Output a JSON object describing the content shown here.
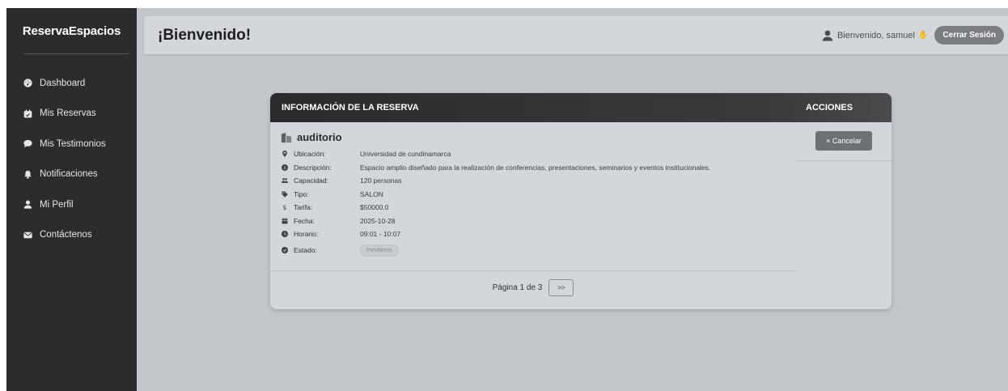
{
  "sidebar": {
    "brand": "ReservaEspacios",
    "items": [
      {
        "label": "Dashboard",
        "icon": "dashboard-icon"
      },
      {
        "label": "Mis Reservas",
        "icon": "calendar-icon"
      },
      {
        "label": "Mis Testimonios",
        "icon": "comment-icon"
      },
      {
        "label": "Notificaciones",
        "icon": "bell-icon"
      },
      {
        "label": "Mi Perfil",
        "icon": "user-icon"
      },
      {
        "label": "Contáctenos",
        "icon": "envelope-icon"
      }
    ]
  },
  "header": {
    "title": "¡Bienvenido!",
    "welcome": "Bienvenido, samuel",
    "logout_label": "Cerrar Sesión"
  },
  "card": {
    "info_header": "INFORMACIÓN DE LA RESERVA",
    "actions_header": "ACCIONES",
    "cancel_label": "× Cancelar",
    "space_name": "auditorio",
    "fields": {
      "ubicacion": {
        "label": "Ubicación:",
        "value": "Universidad de cundinamarca"
      },
      "descripcion": {
        "label": "Descripción:",
        "value": "Espacio amplio diseñado para la realización de conferencias, presentaciones, seminarios y eventos institucionales."
      },
      "capacidad": {
        "label": "Capacidad:",
        "value": "120 personas"
      },
      "tipo": {
        "label": "Tipo:",
        "value": "SALON"
      },
      "tarifa": {
        "label": "Tarifa:",
        "value": "$50000.0"
      },
      "fecha": {
        "label": "Fecha:",
        "value": "2025-10-28"
      },
      "horario": {
        "label": "Horario:",
        "value": "09:01 - 10:07"
      },
      "estado": {
        "label": "Estado:",
        "value": "Pendiente"
      }
    },
    "pagination": {
      "text": "Página 1 de 3",
      "next_label": ">>"
    }
  },
  "colors": {
    "sidebar_bg": "#2c2c2e",
    "main_bg": "#c3c6cb",
    "header_bg": "#2b2b2d",
    "button_bg": "#6d7075"
  }
}
